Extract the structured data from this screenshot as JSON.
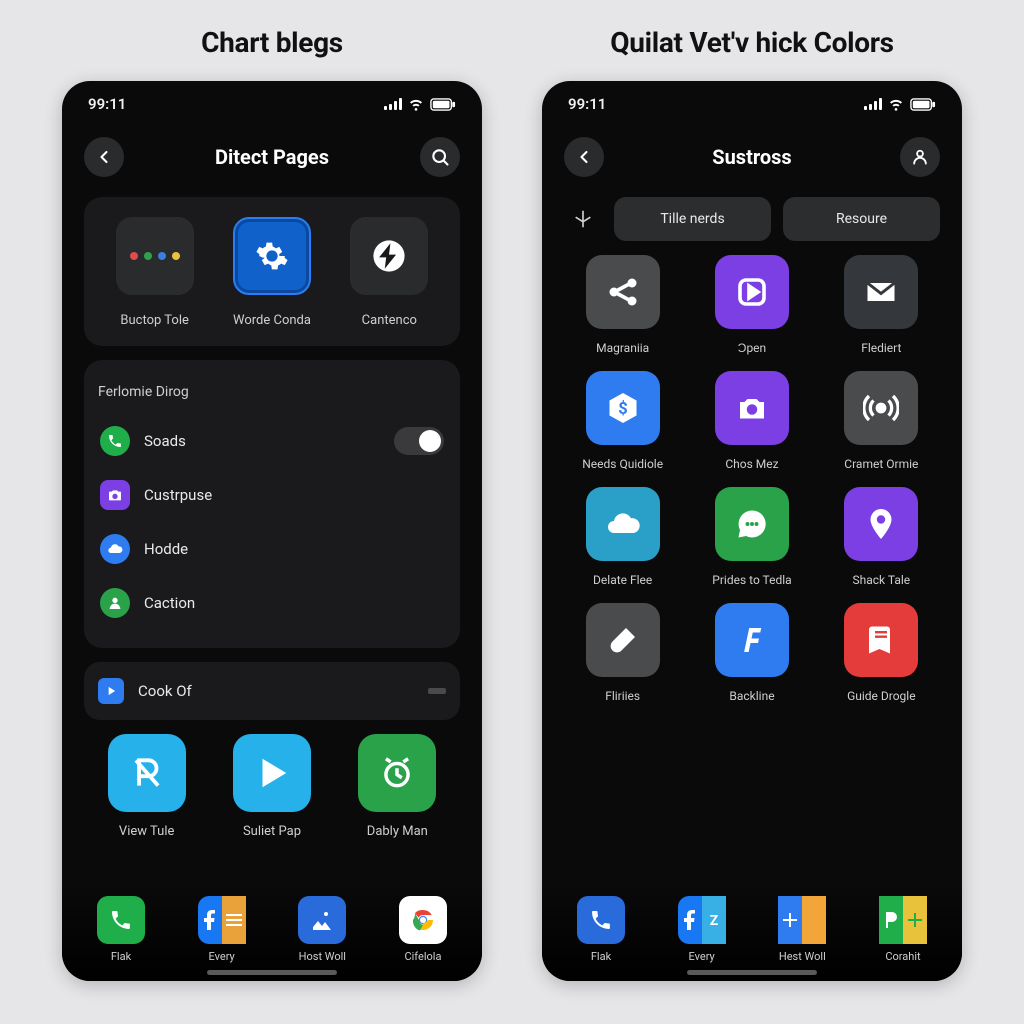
{
  "left": {
    "heading": "Chart blegs",
    "status_time": "99:11",
    "page_title": "Ditect Pages",
    "tiles": [
      {
        "label": "Buctop Tole"
      },
      {
        "label": "Worde Conda"
      },
      {
        "label": "Cantenco"
      }
    ],
    "section_heading": "Ferlomie Dirog",
    "list": [
      {
        "icon": "phone-icon",
        "color": "#1fae4a",
        "label": "Soads",
        "toggle": true
      },
      {
        "icon": "camera-icon",
        "color": "#7b3fe4",
        "label": "Custrpuse"
      },
      {
        "icon": "cloud-icon",
        "color": "#2e7cf0",
        "label": "Hodde"
      },
      {
        "icon": "person-icon",
        "color": "#29a24a",
        "label": "Caction"
      }
    ],
    "thin_row": {
      "label": "Cook Of"
    },
    "apps": [
      {
        "label": "View Tule",
        "bg": "#26b1ea"
      },
      {
        "label": "Suliet Pap",
        "bg": "#26b1ea"
      },
      {
        "label": "Dably Man",
        "bg": "#29a24a"
      }
    ],
    "dock": [
      {
        "label": "Flak",
        "bg": "#1fae4a"
      },
      {
        "label": "Every",
        "bg": "#1877f2"
      },
      {
        "label": "Host Woll",
        "bg": "#2a6bdc"
      },
      {
        "label": "Cifelola",
        "bg": "#ffffff"
      }
    ]
  },
  "right": {
    "heading": "Quilat Vet'v hick Colors",
    "status_time": "99:11",
    "page_title": "Sustross",
    "chips": [
      "Tille nerds",
      "Resoure"
    ],
    "grid": [
      {
        "label": "Magraniia",
        "bg": "#4a4b4d"
      },
      {
        "label": "Ɔpen",
        "bg": "#7b3fe4"
      },
      {
        "label": "Flediert",
        "bg": "#34373b"
      },
      {
        "label": "Needs Quidiole",
        "bg": "#2e7cf0"
      },
      {
        "label": "Chos Mez",
        "bg": "#7b3fe4"
      },
      {
        "label": "Cramet Ormie",
        "bg": "#4a4b4d"
      },
      {
        "label": "Delate Flee",
        "bg": "#2aa0c8"
      },
      {
        "label": "Prides to Tedla",
        "bg": "#29a24a"
      },
      {
        "label": "Shack Tale",
        "bg": "#7b3fe4"
      },
      {
        "label": "Fliriies",
        "bg": "#4a4b4d"
      },
      {
        "label": "Backline",
        "bg": "#2e7cf0"
      },
      {
        "label": "Guide Drogle",
        "bg": "#e43b3b"
      }
    ],
    "dock": [
      {
        "label": "Flak",
        "bg": "#2a6bdc"
      },
      {
        "label": "Every",
        "bg": "#1877f2"
      },
      {
        "label": "Hest Woll",
        "bg": "#2e7cf0"
      },
      {
        "label": "Corahit",
        "bg": "#1fae4a"
      }
    ]
  }
}
